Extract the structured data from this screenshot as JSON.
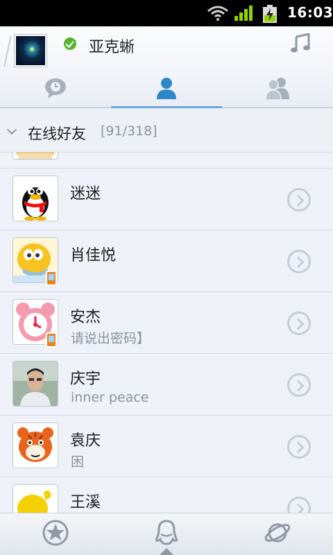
{
  "status_bar": {
    "time": "16:03",
    "icons": [
      "wifi-icon",
      "signal-icon",
      "battery-charging-icon"
    ]
  },
  "header": {
    "nickname": "亚克蜥",
    "status": "online",
    "right_icon": "music-note-icon",
    "tabs": [
      {
        "name": "recent-chats",
        "icon": "chat-bubble-clock-icon"
      },
      {
        "name": "friends",
        "icon": "person-icon",
        "active": true
      },
      {
        "name": "groups",
        "icon": "group-icon"
      }
    ]
  },
  "group": {
    "name": "在线好友",
    "count": "[91/318]"
  },
  "friends": [
    {
      "name": "",
      "signature": ""
    },
    {
      "name": "迷迷",
      "signature": ""
    },
    {
      "name": "肖佳悦",
      "signature": ""
    },
    {
      "name": "安杰",
      "signature": "请说出密码】"
    },
    {
      "name": "庆宇",
      "signature": "inner peace"
    },
    {
      "name": "袁庆",
      "signature": "困"
    },
    {
      "name": "王溪",
      "signature": ""
    }
  ],
  "bottom_nav": [
    {
      "name": "favorites",
      "icon": "star-icon"
    },
    {
      "name": "contacts",
      "icon": "qq-penguin-icon",
      "active": true
    },
    {
      "name": "discover",
      "icon": "planet-icon"
    }
  ],
  "colors": {
    "accent": "#69a8dd",
    "online": "#56b52a",
    "background": "#eef2f8"
  }
}
